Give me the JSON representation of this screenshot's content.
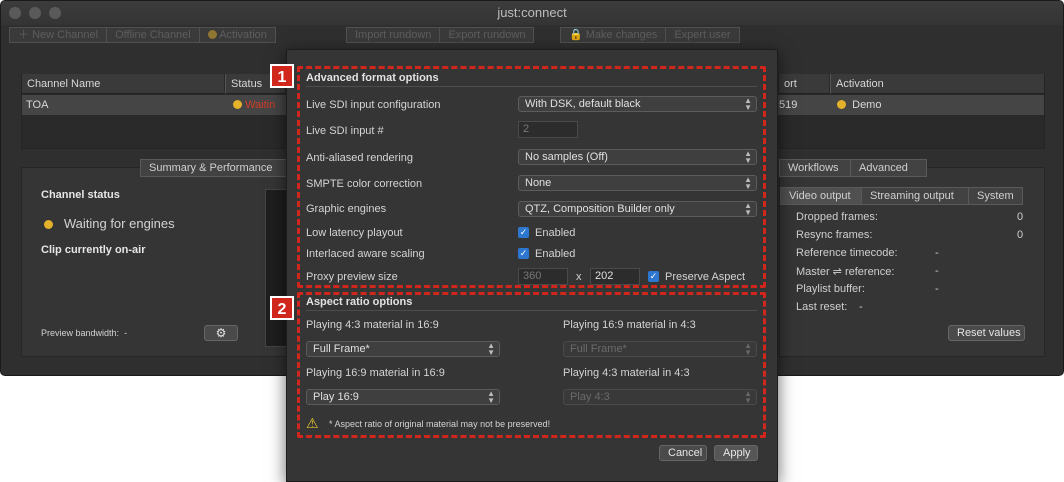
{
  "window": {
    "title": "just:connect"
  },
  "toolbar": {
    "new_channel": "New Channel",
    "offline_channel": "Offline Channel",
    "activation": "Activation",
    "import_rundown": "Import rundown",
    "export_rundown": "Export rundown",
    "make_changes": "Make changes",
    "expert_user": "Expert user"
  },
  "channels_table": {
    "columns": [
      "Channel Name",
      "Status",
      "ort",
      "Activation"
    ],
    "rows": [
      {
        "name": "TOA",
        "status": "Waitin",
        "port": "519",
        "activation": "Demo"
      }
    ]
  },
  "summary": {
    "tab_label": "Summary & Performance",
    "channel_status_heading": "Channel status",
    "channel_status_value": "Waiting for engines",
    "clip_heading": "Clip currently on-air",
    "preview_bandwidth_label": "Preview bandwidth:",
    "preview_bandwidth_value": "-"
  },
  "right_panel": {
    "tabs": [
      "Workflows",
      "Advanced"
    ],
    "subtabs": [
      "Video output",
      "Streaming output",
      "System"
    ],
    "stats": [
      {
        "label": "Dropped frames:",
        "value": "0"
      },
      {
        "label": "Resync frames:",
        "value": "0"
      },
      {
        "label": "Reference timecode:",
        "value": "-"
      },
      {
        "label": "Master ⇌ reference:",
        "value": "-"
      },
      {
        "label": "Playlist buffer:",
        "value": "-"
      },
      {
        "label": "Last reset:",
        "value": "-"
      }
    ],
    "reset_button": "Reset values"
  },
  "dialog": {
    "annotation_1": "1",
    "annotation_2": "2",
    "advanced": {
      "title": "Advanced format options",
      "live_sdi_config_label": "Live SDI input configuration",
      "live_sdi_config_value": "With DSK, default black",
      "live_sdi_input_label": "Live SDI input #",
      "live_sdi_input_value": "2",
      "anti_aliased_label": "Anti-aliased rendering",
      "anti_aliased_value": "No samples (Off)",
      "smpte_label": "SMPTE color correction",
      "smpte_value": "None",
      "graphic_engines_label": "Graphic engines",
      "graphic_engines_value": "QTZ, Composition Builder only",
      "low_latency_label": "Low latency playout",
      "low_latency_check": "Enabled",
      "interlaced_label": "Interlaced aware scaling",
      "interlaced_check": "Enabled",
      "proxy_label": "Proxy preview size",
      "proxy_width": "360",
      "proxy_x": "x",
      "proxy_height": "202",
      "preserve_aspect": "Preserve Aspect"
    },
    "aspect": {
      "title": "Aspect ratio options",
      "p43_in_169_label": "Playing 4:3 material in 16:9",
      "p43_in_169_value": "Full Frame*",
      "p169_in_43_label": "Playing 16:9 material in 4:3",
      "p169_in_43_value": "Full Frame*",
      "p169_in_169_label": "Playing 16:9 material in 16:9",
      "p169_in_169_value": "Play 16:9",
      "p43_in_43_label": "Playing 4:3 material in 4:3",
      "p43_in_43_value": "Play 4:3",
      "warning": "* Aspect ratio of original material may not be preserved!"
    },
    "cancel": "Cancel",
    "apply": "Apply"
  }
}
